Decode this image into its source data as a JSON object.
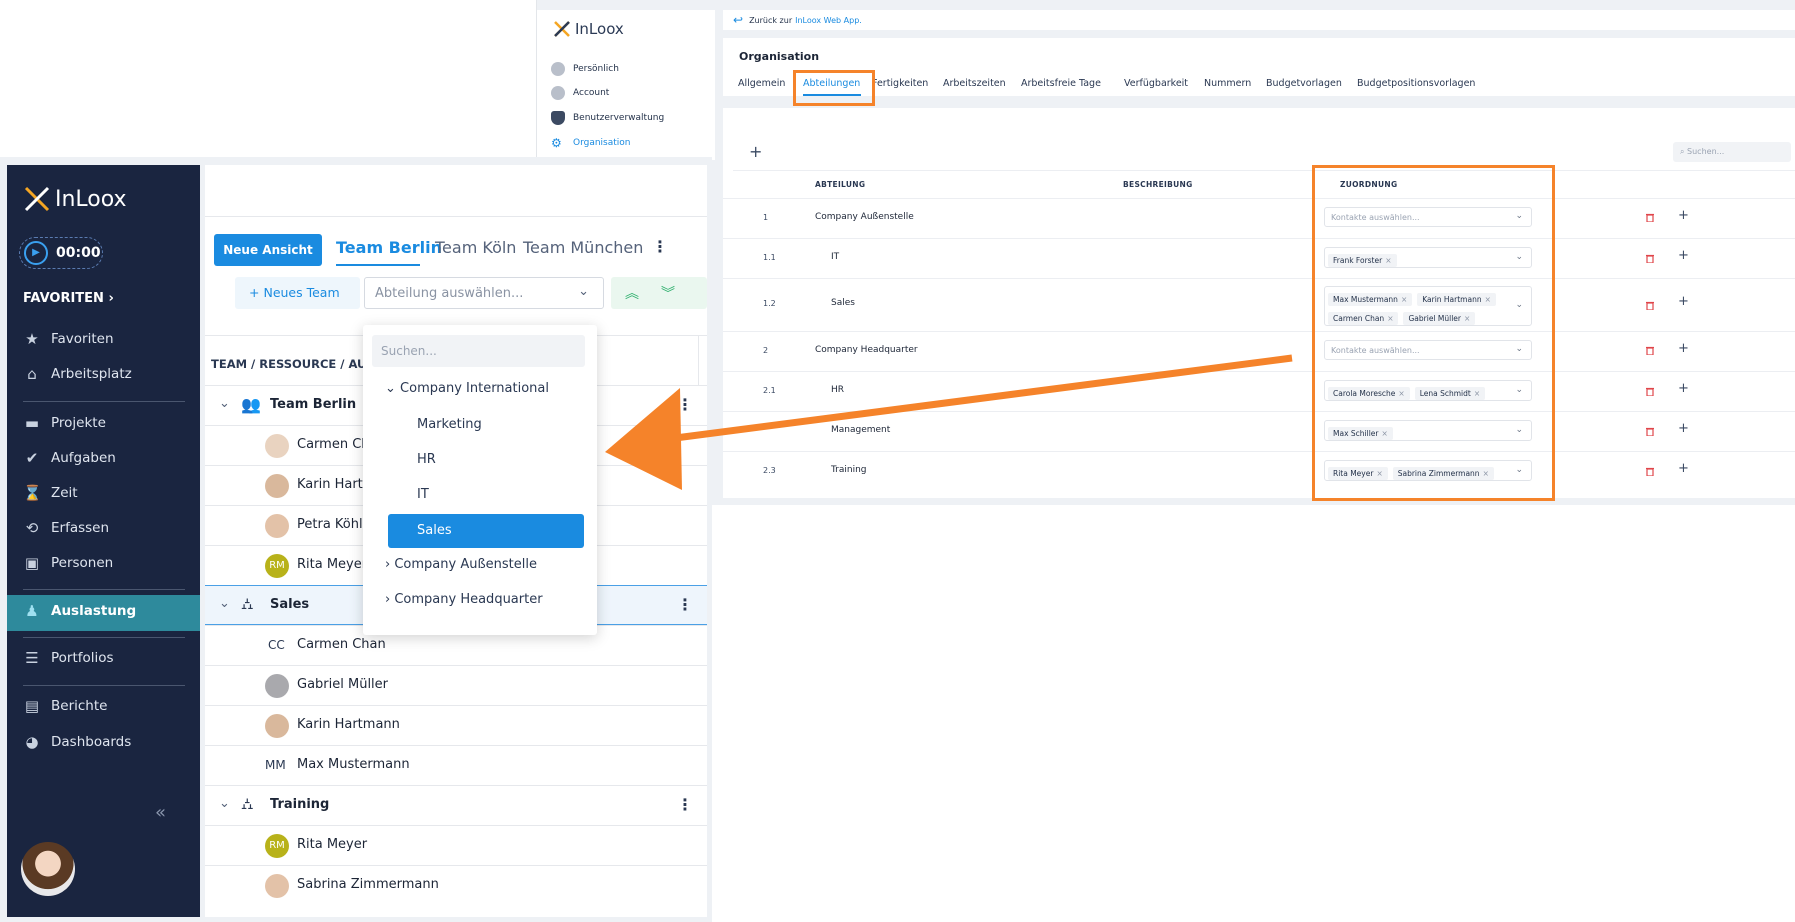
{
  "right_window": {
    "logo": "InLoox",
    "sidebar": [
      {
        "label": "Persönlich",
        "icon": "person-icon"
      },
      {
        "label": "Account",
        "icon": "globe-icon"
      },
      {
        "label": "Benutzerverwaltung",
        "icon": "shield-icon"
      },
      {
        "label": "Organisation",
        "icon": "gears-icon"
      }
    ],
    "back_text": "Zurück zur",
    "back_link": "InLoox Web App.",
    "section_title": "Organisation",
    "tabs": [
      "Allgemein",
      "Abteilungen",
      "Fertigkeiten",
      "Arbeitszeiten",
      "Arbeitsfreie Tage",
      "Verfügbarkeit",
      "Nummern",
      "Budgetvorlagen",
      "Budgetpositionsvorlagen"
    ],
    "search_placeholder": "Suchen...",
    "columns": [
      "ABTEILUNG",
      "BESCHREIBUNG",
      "ZUORDNUNG"
    ],
    "select_placeholder": "Kontakte auswählen...",
    "rows": [
      {
        "num": "1",
        "name": "Company Außenstelle",
        "chips": []
      },
      {
        "num": "1.1",
        "name": "IT",
        "chips": [
          "Frank Forster"
        ]
      },
      {
        "num": "1.2",
        "name": "Sales",
        "chips": [
          "Max Mustermann",
          "Karin Hartmann",
          "Carmen Chan",
          "Gabriel Müller"
        ]
      },
      {
        "num": "2",
        "name": "Company Headquarter",
        "chips": []
      },
      {
        "num": "2.1",
        "name": "HR",
        "chips": [
          "Carola Moresche",
          "Lena Schmidt"
        ]
      },
      {
        "num": "",
        "name": "Management",
        "chips": [
          "Max Schiller"
        ]
      },
      {
        "num": "2.3",
        "name": "Training",
        "chips": [
          "Rita Meyer",
          "Sabrina Zimmermann"
        ]
      }
    ]
  },
  "left_window": {
    "logo": "InLoox",
    "timer": "00:00",
    "favorites_header": "FAVORITEN",
    "nav": [
      {
        "label": "Favoriten",
        "icon": "star-icon"
      },
      {
        "label": "Arbeitsplatz",
        "icon": "home-icon"
      },
      {
        "label": "Projekte",
        "icon": "folder-icon"
      },
      {
        "label": "Aufgaben",
        "icon": "check-circle-icon"
      },
      {
        "label": "Zeit",
        "icon": "hourglass-icon"
      },
      {
        "label": "Erfassen",
        "icon": "clock-edit-icon"
      },
      {
        "label": "Personen",
        "icon": "contacts-icon"
      },
      {
        "label": "Auslastung",
        "icon": "workload-icon"
      },
      {
        "label": "Portfolios",
        "icon": "portfolio-icon"
      },
      {
        "label": "Berichte",
        "icon": "report-icon"
      },
      {
        "label": "Dashboards",
        "icon": "pie-chart-icon"
      }
    ],
    "new_view_button": "Neue Ansicht",
    "view_tabs": [
      "Team Berlin",
      "Team Köln",
      "Team München"
    ],
    "new_team_button": "Neues Team",
    "department_select_placeholder": "Abteilung auswählen...",
    "column_header": "TEAM / RESSOURCE / AUF",
    "groups": [
      {
        "name": "Team Berlin",
        "members": [
          {
            "name": "Carmen Ch",
            "initials": ""
          },
          {
            "name": "Karin Hartn",
            "initials": ""
          },
          {
            "name": "Petra Köhle",
            "initials": ""
          },
          {
            "name": "Rita Meyer",
            "initials": "RM"
          }
        ]
      },
      {
        "name": "Sales",
        "members": [
          {
            "name": "Carmen Chan",
            "initials": "CC"
          },
          {
            "name": "Gabriel Müller",
            "initials": ""
          },
          {
            "name": "Karin Hartmann",
            "initials": ""
          },
          {
            "name": "Max Mustermann",
            "initials": "MM"
          }
        ]
      },
      {
        "name": "Training",
        "members": [
          {
            "name": "Rita Meyer",
            "initials": "RM"
          },
          {
            "name": "Sabrina Zimmermann",
            "initials": ""
          }
        ]
      }
    ],
    "dropdown": {
      "search_placeholder": "Suchen...",
      "items": [
        {
          "label": "Company International",
          "level": 0,
          "expanded": true
        },
        {
          "label": "Marketing",
          "level": 1
        },
        {
          "label": "HR",
          "level": 1
        },
        {
          "label": "IT",
          "level": 1
        },
        {
          "label": "Sales",
          "level": 1,
          "selected": true
        },
        {
          "label": "Company Außenstelle",
          "level": 0,
          "expanded": false
        },
        {
          "label": "Company Headquarter",
          "level": 0,
          "expanded": false
        }
      ]
    }
  },
  "colors": {
    "sidebar_bg": "#1a2540",
    "accent_blue": "#1a8be0",
    "active_teal": "#2e8a9c",
    "annotation_orange": "#f5832a",
    "delete_red": "#e0454a"
  }
}
